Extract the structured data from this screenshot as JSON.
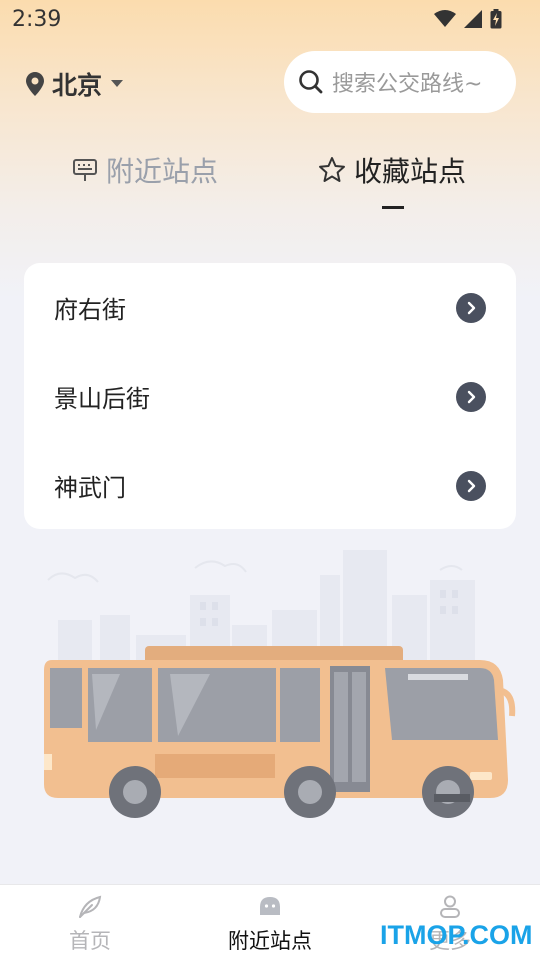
{
  "status": {
    "time": "2:39"
  },
  "header": {
    "city": "北京",
    "search_placeholder": "搜索公交路线~"
  },
  "tabs": [
    {
      "label": "附近站点",
      "icon": "bus-stop-sign-icon",
      "active": false
    },
    {
      "label": "收藏站点",
      "icon": "star-icon",
      "active": true
    }
  ],
  "stations": [
    {
      "name": "府右街"
    },
    {
      "name": "景山后街"
    },
    {
      "name": "神武门"
    }
  ],
  "bottom_nav": [
    {
      "label": "首页",
      "icon": "feather-icon"
    },
    {
      "label": "附近站点",
      "icon": "bus-face-icon"
    },
    {
      "label": "更多",
      "icon": "user-icon"
    }
  ],
  "watermark": "ITMOP.COM",
  "colors": {
    "accent_dark": "#4a505f",
    "header_gradient_top": "#fbdcae",
    "background": "#f1f2f8",
    "bus_body": "#f2bf90"
  }
}
